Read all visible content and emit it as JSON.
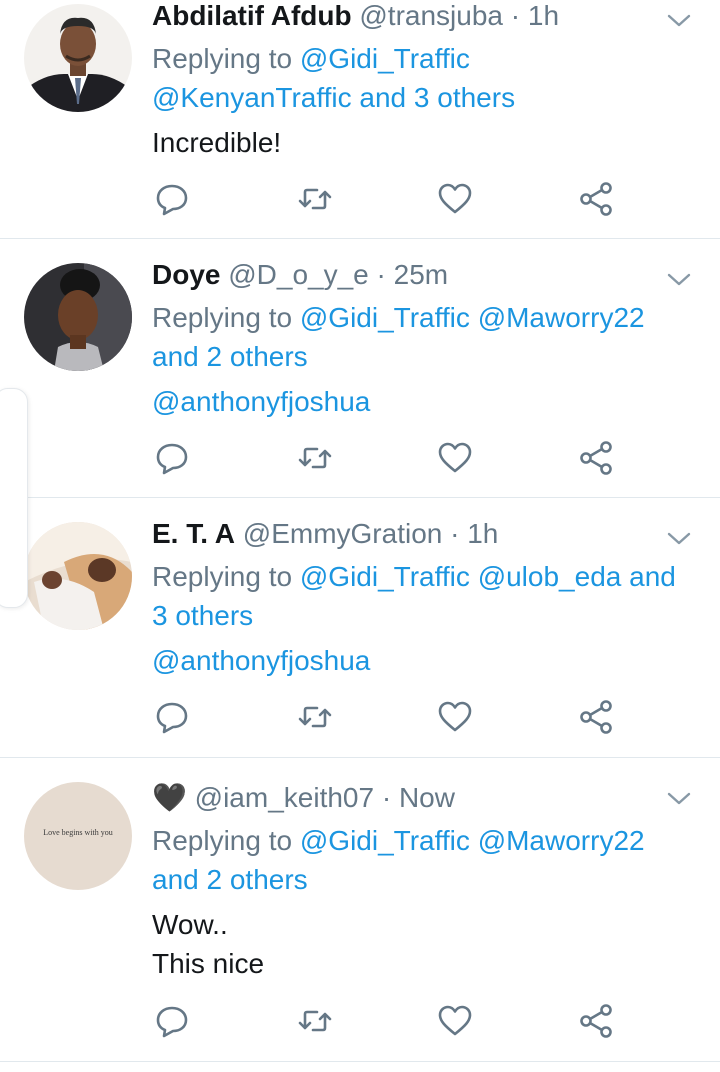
{
  "colors": {
    "link": "#1b95e0",
    "muted": "#657786",
    "text": "#14171a",
    "divider": "#e1e8ed"
  },
  "tweets": [
    {
      "display_name": "Abdilatif Afdub",
      "handle": "@transjuba",
      "separator": "·",
      "time": "1h",
      "replying_prefix": "Replying to",
      "mentions": [
        "@Gidi_Traffic",
        "@KenyanTraffic"
      ],
      "others": "and 3 others",
      "body": [
        "Incredible!"
      ],
      "avatar_icon": "man-in-suit-avatar"
    },
    {
      "display_name": "Doye",
      "handle": "@D_o_y_e",
      "separator": "·",
      "time": "25m",
      "replying_prefix": "Replying to",
      "mentions": [
        "@Gidi_Traffic",
        "@Maworry22"
      ],
      "others": "and 2 others",
      "body_link": "@anthonyfjoshua",
      "avatar_icon": "woman-selfie-avatar"
    },
    {
      "display_name": "E. T. A",
      "handle": "@EmmyGration",
      "separator": "·",
      "time": "1h",
      "replying_prefix": "Replying to",
      "mentions": [
        "@Gidi_Traffic",
        "@ulob_eda"
      ],
      "others_line1": "and",
      "others_line2": "3 others",
      "body_link": "@anthonyfjoshua",
      "avatar_icon": "photo-avatar"
    },
    {
      "display_name": "🖤",
      "handle": "@iam_keith07",
      "separator": "·",
      "time": "Now",
      "replying_prefix": "Replying to",
      "mentions": [
        "@Gidi_Traffic",
        "@Maworry22"
      ],
      "others": "and 2 others",
      "body": [
        "Wow..",
        "This nice"
      ],
      "avatar_text": "Love begins with you",
      "avatar_icon": "text-avatar"
    }
  ],
  "actions": [
    "reply-icon",
    "retweet-icon",
    "like-icon",
    "share-icon"
  ]
}
